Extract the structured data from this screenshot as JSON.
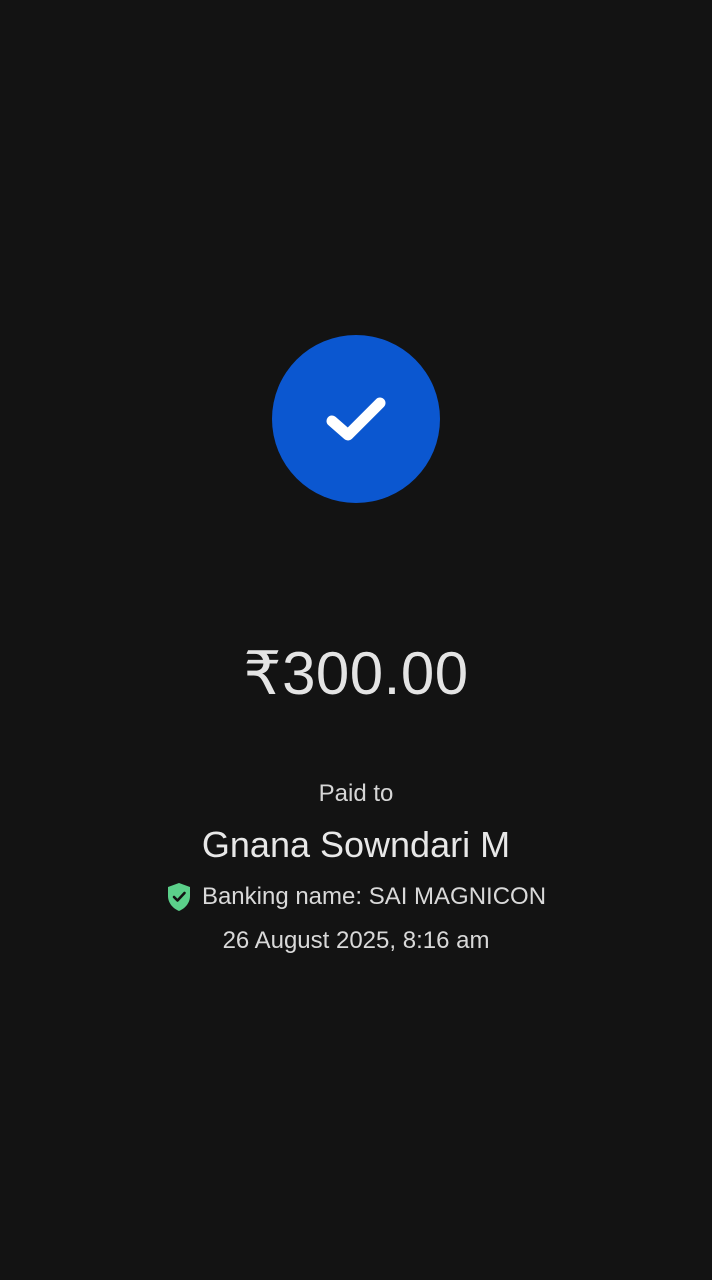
{
  "status": {
    "icon": "checkmark-icon",
    "circle_color": "#0b57d0"
  },
  "payment": {
    "amount": "₹300.00",
    "paid_to_label": "Paid to",
    "payee_name": "Gnana Sowndari M",
    "verified_icon": "shield-check-icon",
    "verified_icon_color": "#5bd08a",
    "banking_name": "Banking name: SAI MAGNICON",
    "datetime": "26 August 2025, 8:16 am"
  }
}
